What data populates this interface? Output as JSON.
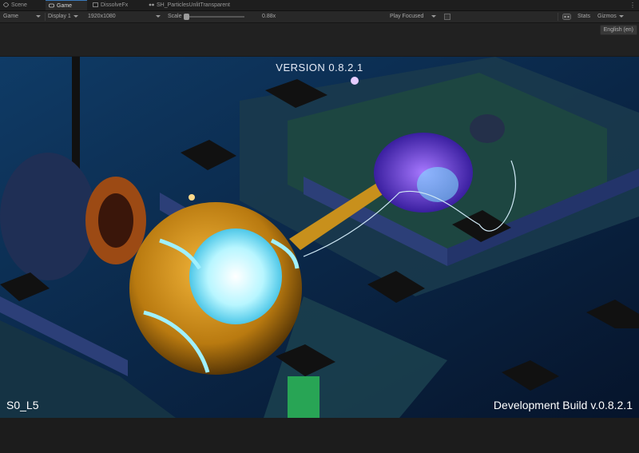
{
  "tabs": [
    {
      "label": "Scene",
      "icon": "scene-icon",
      "active": false
    },
    {
      "label": "Game",
      "icon": "game-icon",
      "active": true
    },
    {
      "label": "DissolveFx",
      "icon": "effect-icon",
      "active": false
    },
    {
      "label": "SH_ParticlesUnlitTransparent",
      "icon": "shader-graph-icon",
      "active": false
    }
  ],
  "tabs_menu_glyph": "⋮",
  "toolbar": {
    "view_mode": "Game",
    "display": "Display 1",
    "resolution": "1920x1080",
    "scale_label": "Scale",
    "scale_value": "0.88x",
    "play_mode": "Play Focused",
    "stats_label": "Stats",
    "gizmos_label": "Gizmos"
  },
  "language": "English (en)",
  "overlay": {
    "version": "VERSION 0.8.2.1",
    "level": "S0_L5",
    "build": "Development Build v.0.8.2.1"
  },
  "colors": {
    "accent": "#3a79bb",
    "scene_bg": "#0b1a33",
    "ball": "#c88a14",
    "glow": "#7ee8ff"
  }
}
